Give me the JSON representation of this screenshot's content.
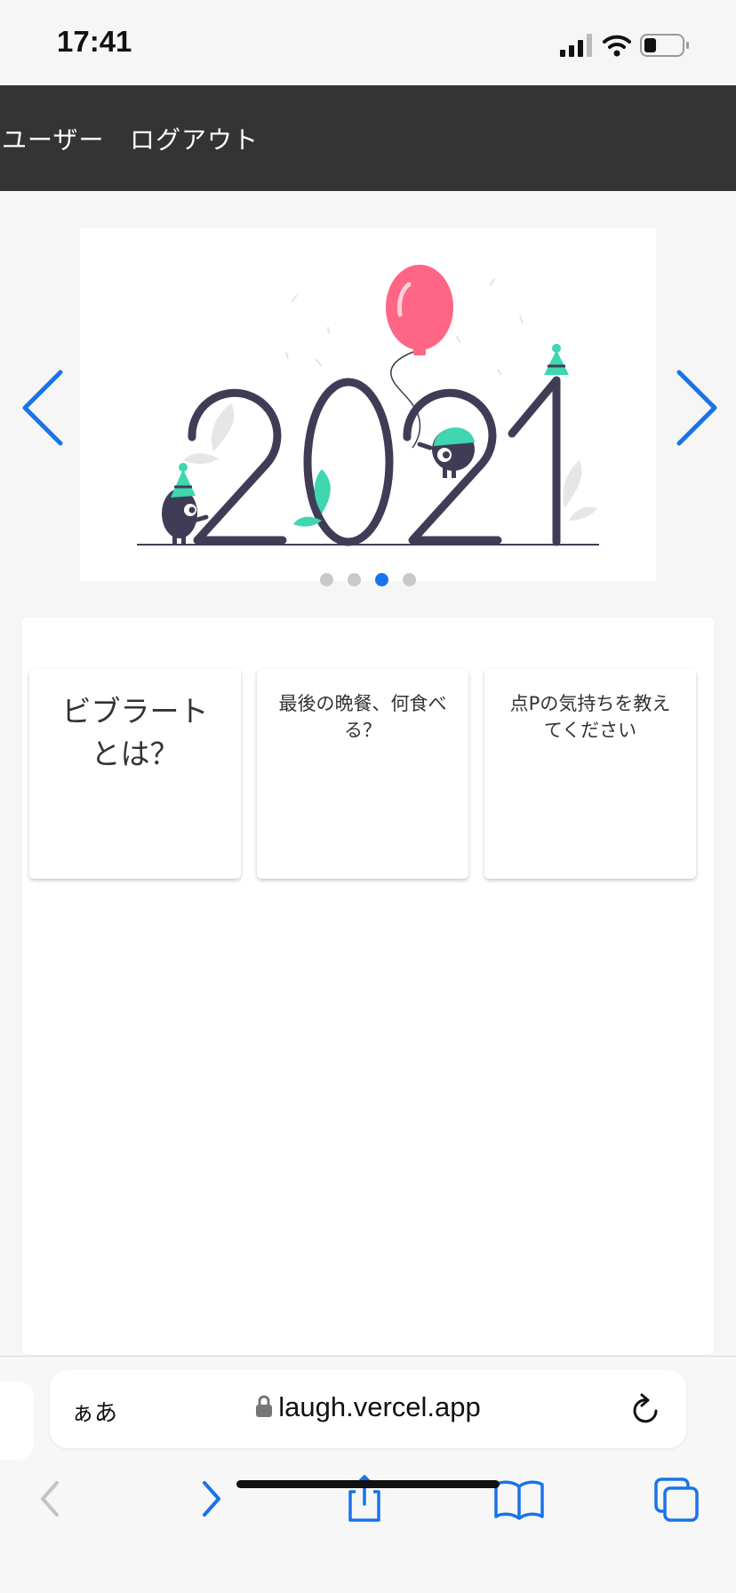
{
  "status": {
    "time": "17:41"
  },
  "nav": {
    "items": [
      "ユーザー",
      "ログアウト"
    ]
  },
  "carousel": {
    "image_text": "2021",
    "slide_count": 4,
    "active_slide": 3,
    "colors": {
      "balloon": "#ff6584",
      "accent": "#3fd6b0",
      "figure": "#3f3d56"
    }
  },
  "topics": [
    {
      "title": "ビブラートとは？"
    },
    {
      "title": "最後の晩餐、何食べる？"
    },
    {
      "title": "点Pの気持ちを教えてください"
    }
  ],
  "browser": {
    "text_size_label": "ぁあ",
    "url": "laugh.vercel.app"
  },
  "colors": {
    "accent": "#1a73e8",
    "navbar": "#343434"
  }
}
